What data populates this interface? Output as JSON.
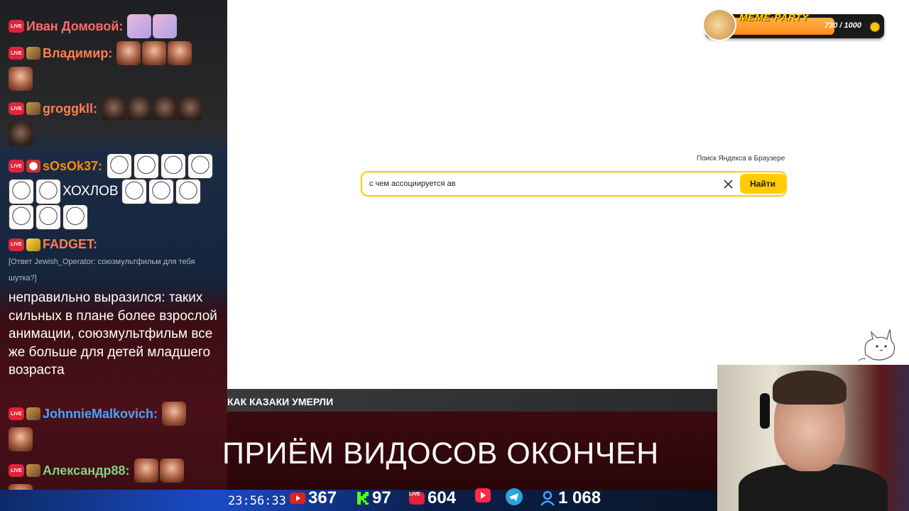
{
  "chat": {
    "messages": [
      {
        "user": "Иван Домовой:",
        "color": "#ff6b6b",
        "text": ""
      },
      {
        "user": "Владимир:",
        "color": "#ff7f50",
        "text": ""
      },
      {
        "user": "groggkll:",
        "color": "#ff7f50",
        "text": ""
      },
      {
        "user": "sOsOk37:",
        "color": "#ff8c00",
        "text": "ХОХЛОВ"
      },
      {
        "user": "FADGET:",
        "color": "#ff7f50",
        "reply": "[Ответ Jewish_Operator: союзмультфильм для тебя шутка?]",
        "text": "неправильно выразился: таких сильных в плане более взрослой анимации, союзмультфильм все же больше для детей младшего возраста"
      },
      {
        "user": "JohnnieMalkovich:",
        "color": "#4aa3ff",
        "text": ""
      },
      {
        "user": "Александр88:",
        "color": "#7fd37f",
        "text": ""
      }
    ],
    "live_label": "LIVE"
  },
  "browser": {
    "search_caption": "Поиск Яндекса в Браузере",
    "search_value": "с чем ассоциируется ав",
    "search_button": "Найти"
  },
  "meme_party": {
    "title": "MEME·PARTY",
    "count": "730 / 1000",
    "progress": 0.73
  },
  "stream": {
    "video_title": "КАК КАЗАКИ УМЕРЛИ",
    "banner": "ПРИЁМ ВИДОСОВ ОКОНЧЕН",
    "clock": "23:56:33",
    "stats": {
      "youtube": "367",
      "kick": "97",
      "vk_live": "604",
      "viewers": "1 068"
    }
  }
}
